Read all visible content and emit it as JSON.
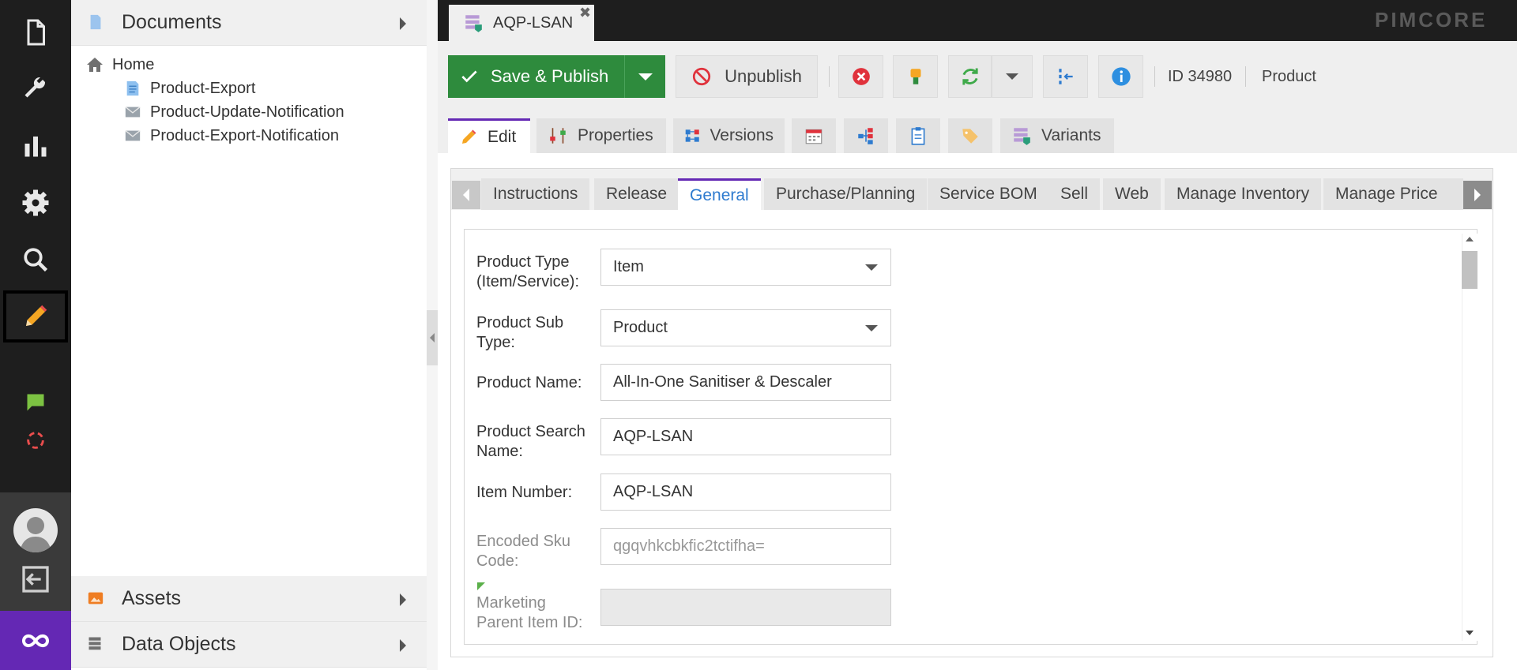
{
  "rail": {
    "icons": [
      "document-icon",
      "wrench-icon",
      "bar-chart-icon",
      "gear-icon",
      "search-icon",
      "pencil-icon",
      "chat-icon",
      "sync-icon",
      "avatar",
      "logout-icon",
      "infinity-logo"
    ]
  },
  "tree_panel": {
    "documents_label": "Documents",
    "assets_label": "Assets",
    "data_objects_label": "Data Objects",
    "nodes": [
      {
        "label": "Home",
        "icon": "home-icon"
      },
      {
        "label": "Product-Export",
        "icon": "page-icon"
      },
      {
        "label": "Product-Update-Notification",
        "icon": "email-icon"
      },
      {
        "label": "Product-Export-Notification",
        "icon": "email-icon"
      }
    ]
  },
  "tabbar": {
    "doc_tab_label": "AQP-LSAN",
    "close_glyph": "✖",
    "brand": "PIMCORE"
  },
  "toolbar": {
    "save_label": "Save & Publish",
    "unpublish_label": "Unpublish",
    "id_text": "ID 34980",
    "class_text": "Product"
  },
  "object_tabs": {
    "edit": "Edit",
    "properties": "Properties",
    "versions": "Versions",
    "variants": "Variants"
  },
  "inner_tabs": [
    "Instructions",
    "Release",
    "General",
    "Purchase/Planning",
    "Service BOM",
    "Sell",
    "Web",
    "Manage Inventory",
    "Manage Price"
  ],
  "form": {
    "product_type": {
      "label": "Product Type (Item/Service):",
      "value": "Item"
    },
    "product_sub_type": {
      "label": "Product Sub Type:",
      "value": "Product"
    },
    "product_name": {
      "label": "Product Name:",
      "value": "All-In-One Sanitiser & Descaler"
    },
    "product_search_name": {
      "label": "Product Search Name:",
      "value": "AQP-LSAN"
    },
    "item_number": {
      "label": "Item Number:",
      "value": "AQP-LSAN"
    },
    "encoded_sku": {
      "label": "Encoded Sku Code:",
      "value": "qgqvhkcbkfic2tctifha="
    },
    "marketing_parent": {
      "label": "Marketing Parent Item ID:",
      "value": ""
    }
  },
  "colors": {
    "accent": "#6428b4",
    "save_green": "#2e8b3d",
    "active_tab_text": "#2e7bcf"
  }
}
